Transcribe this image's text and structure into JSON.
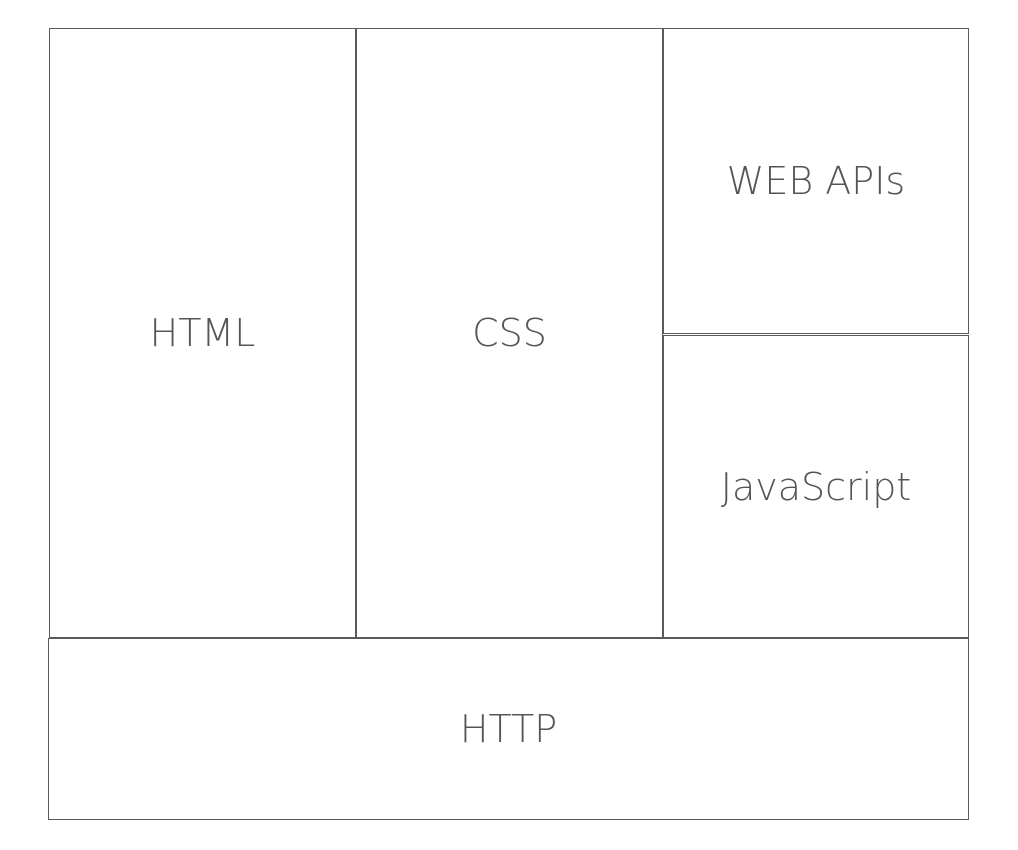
{
  "diagram": {
    "blocks": [
      {
        "label": "HTML"
      },
      {
        "label": "CSS"
      },
      {
        "label": "WEB APIs"
      },
      {
        "label": "JavaScript"
      },
      {
        "label": "HTTP"
      }
    ],
    "colors": {
      "border": "#5a5a5a",
      "text": "#555555",
      "background": "#ffffff"
    }
  }
}
